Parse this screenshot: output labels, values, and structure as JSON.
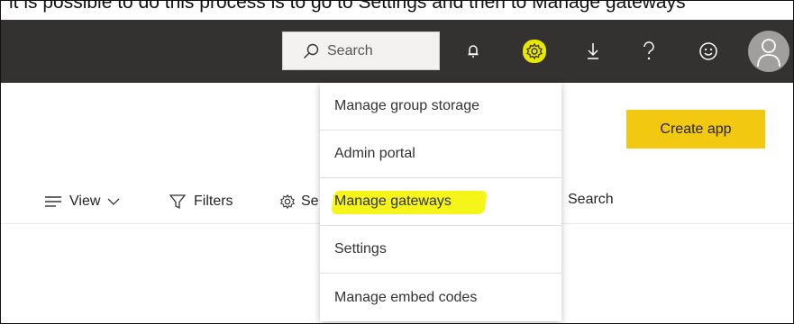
{
  "top_strip": {
    "text": "it is possible to do this process is to go to Settings and then to Manage gateways"
  },
  "header": {
    "search_placeholder": "Search",
    "icons": [
      "bell-icon",
      "gear-icon",
      "download-icon",
      "help-icon",
      "smiley-icon",
      "avatar-icon"
    ],
    "colors": {
      "bar": "#333231",
      "gear_highlight": "#e9e900"
    }
  },
  "actions": {
    "create_app_label": "Create app",
    "accent": "#f2c811"
  },
  "toolbar": {
    "view_label": "View",
    "filters_label": "Filters",
    "settings_partial": "Se",
    "search_label": "Search"
  },
  "settings_menu": {
    "items": [
      {
        "label": "Manage group storage"
      },
      {
        "label": "Admin portal"
      },
      {
        "label": "Manage gateways",
        "highlighted": true
      },
      {
        "label": "Settings"
      },
      {
        "label": "Manage embed codes"
      }
    ]
  }
}
